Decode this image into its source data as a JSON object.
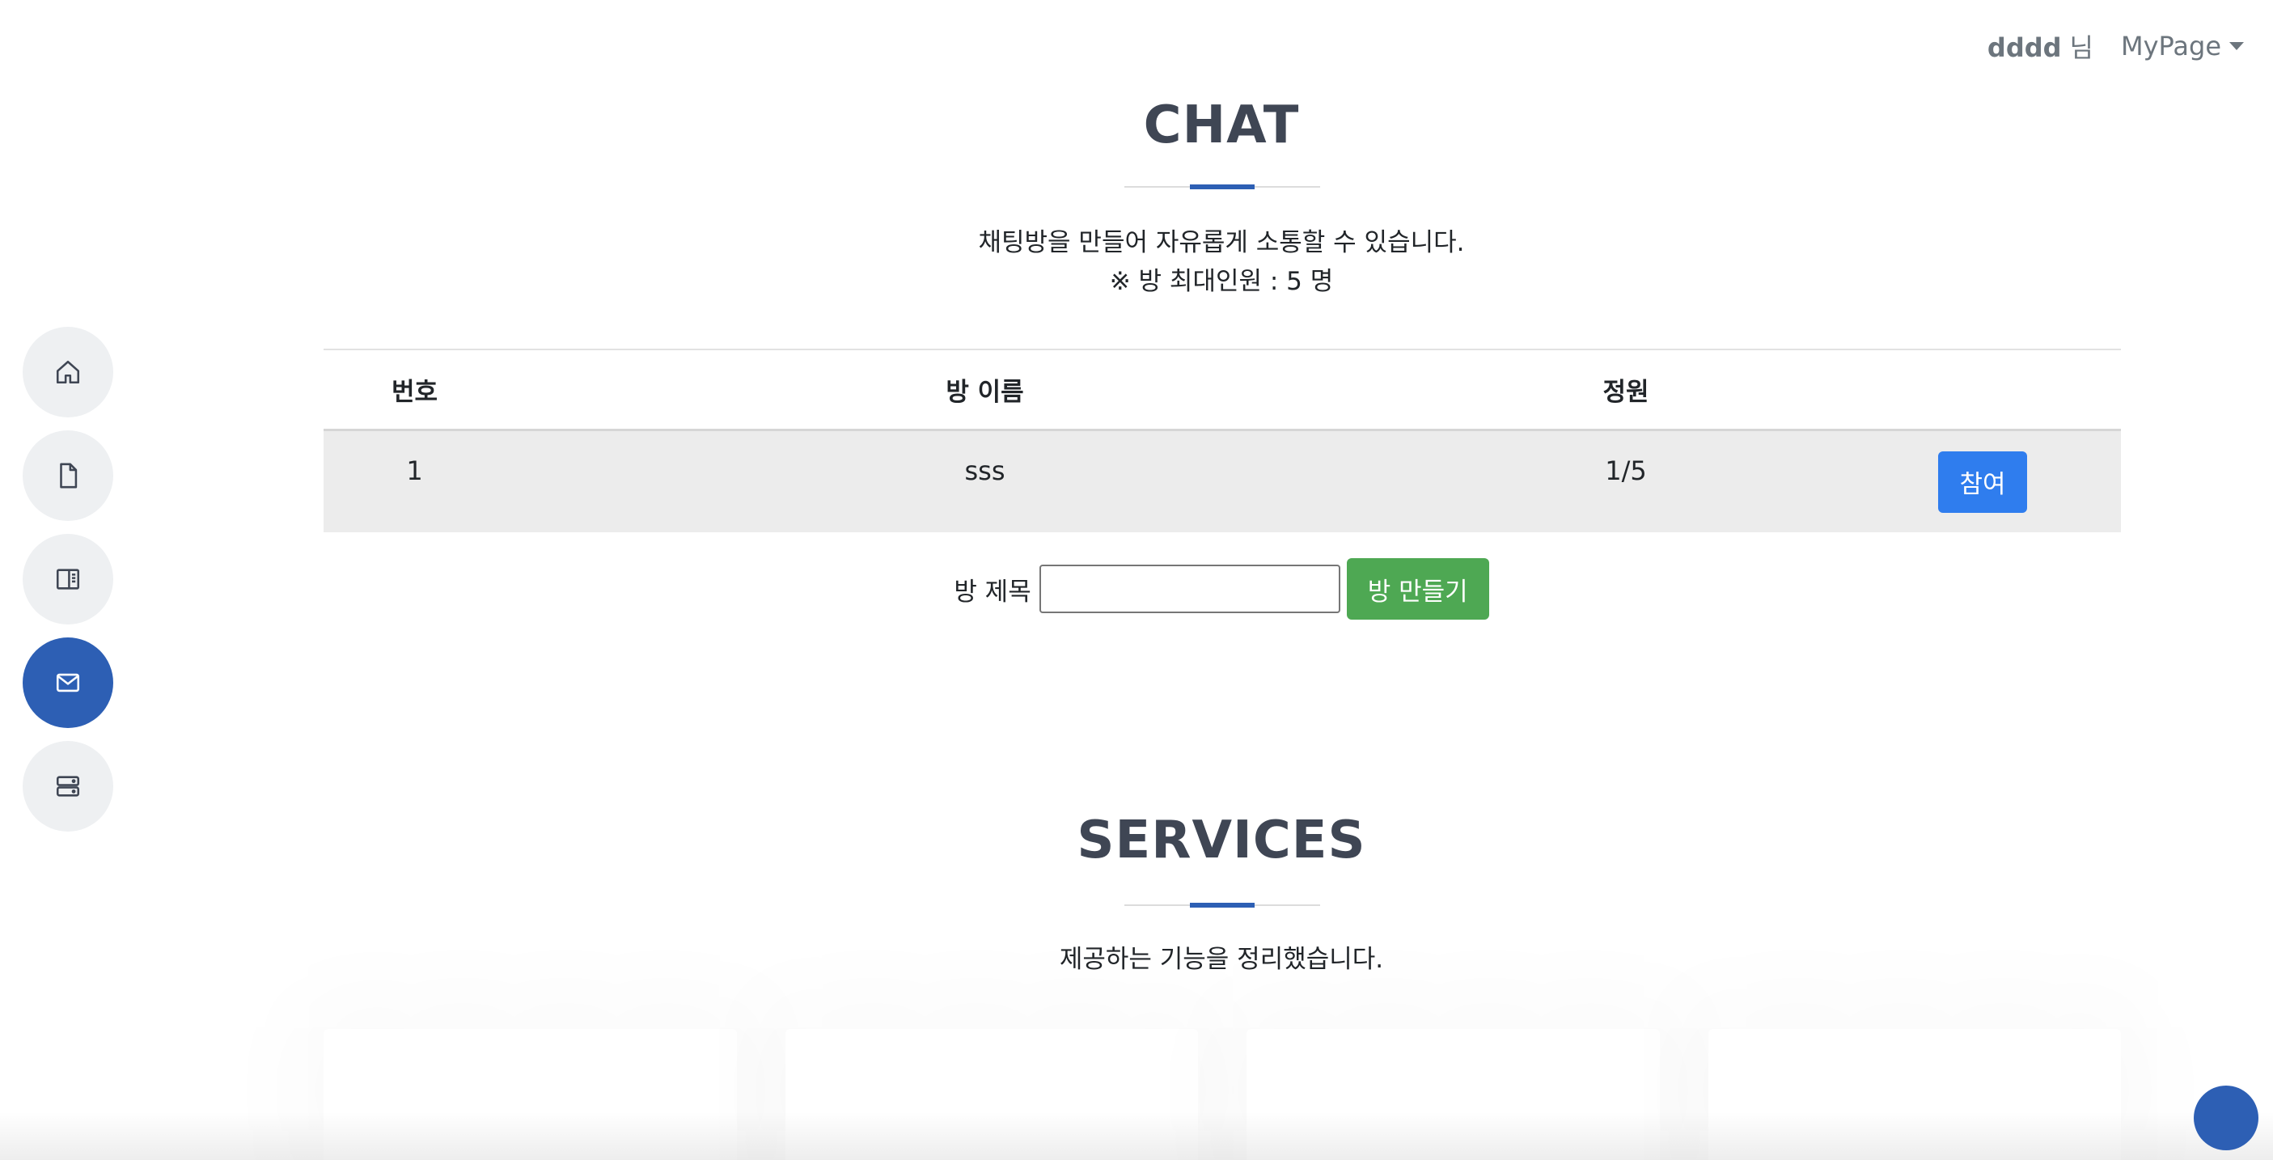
{
  "header": {
    "user_name": "dddd",
    "user_suffix": "님",
    "mypage_label": "MyPage"
  },
  "sidenav": {
    "items": [
      {
        "icon": "home-icon",
        "active": false
      },
      {
        "icon": "file-icon",
        "active": false
      },
      {
        "icon": "layout-icon",
        "active": false
      },
      {
        "icon": "mail-icon",
        "active": true
      },
      {
        "icon": "server-icon",
        "active": false
      }
    ]
  },
  "chat": {
    "title": "CHAT",
    "description_line1": "채팅방을 만들어 자유롭게 소통할 수 있습니다.",
    "description_line2": "※ 방 최대인원 : 5 명",
    "table": {
      "headers": [
        "번호",
        "방 이름",
        "정원",
        ""
      ],
      "rows": [
        {
          "number": "1",
          "name": "sss",
          "capacity": "1/5",
          "action": "참여"
        }
      ]
    },
    "form": {
      "label": "방 제목",
      "input_value": "",
      "button_label": "방 만들기"
    }
  },
  "services": {
    "title": "SERVICES",
    "description": "제공하는 기능을 정리했습니다."
  },
  "colors": {
    "accent": "#2d5fb4",
    "join_button": "#2f7dee",
    "create_button": "#4ea853",
    "heading": "#3f4654"
  }
}
